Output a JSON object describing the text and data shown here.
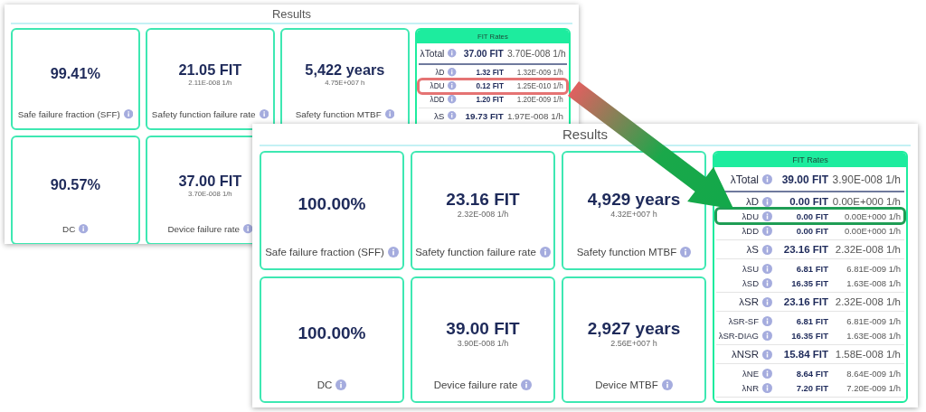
{
  "screens": [
    {
      "title": "Results",
      "cards": [
        {
          "value": "99.41%",
          "label": "Safe failure fraction (SFF)"
        },
        {
          "value": "21.05 FIT",
          "sub": "2.11E-008 1/h",
          "label": "Safety function failure rate"
        },
        {
          "value": "5,422 years",
          "sub": "4.75E+007 h",
          "label": "Safety function MTBF"
        },
        {
          "value": "90.57%",
          "label": "DC"
        },
        {
          "value": "37.00 FIT",
          "sub": "3.70E-008 1/h",
          "label": "Device failure rate"
        }
      ],
      "fit_rates": {
        "title": "FIT Rates",
        "groups": [
          {
            "rows": [
              {
                "label": "λTotal",
                "value": "37.00 FIT",
                "rate": "3.70E-008 1/h",
                "kind": "total",
                "highlighted": false
              }
            ]
          },
          {
            "rows": [
              {
                "label": "λD",
                "value": "1.32 FIT",
                "rate": "1.32E-009 1/h",
                "kind": "minor",
                "highlighted": false
              },
              {
                "label": "λDU",
                "value": "0.12 FIT",
                "rate": "1.25E-010 1/h",
                "kind": "minor",
                "highlighted": true,
                "color": "#e57373"
              },
              {
                "label": "λDD",
                "value": "1.20 FIT",
                "rate": "1.20E-009 1/h",
                "kind": "minor",
                "highlighted": false
              }
            ]
          },
          {
            "rows": [
              {
                "label": "λS",
                "value": "19.73 FIT",
                "rate": "1.97E-008 1/h",
                "kind": "major",
                "highlighted": false
              }
            ]
          }
        ]
      }
    },
    {
      "title": "Results",
      "cards": [
        {
          "value": "100.00%",
          "label": "Safe failure fraction (SFF)"
        },
        {
          "value": "23.16 FIT",
          "sub": "2.32E-008 1/h",
          "label": "Safety function failure rate"
        },
        {
          "value": "4,929 years",
          "sub": "4.32E+007 h",
          "label": "Safety function MTBF"
        },
        {
          "value": "100.00%",
          "label": "DC"
        },
        {
          "value": "39.00 FIT",
          "sub": "3.90E-008 1/h",
          "label": "Device failure rate"
        },
        {
          "value": "2,927 years",
          "sub": "2.56E+007 h",
          "label": "Device MTBF"
        }
      ],
      "fit_rates": {
        "title": "FIT Rates",
        "groups": [
          {
            "rows": [
              {
                "label": "λTotal",
                "value": "39.00 FIT",
                "rate": "3.90E-008 1/h",
                "kind": "total",
                "highlighted": false
              }
            ]
          },
          {
            "rows": [
              {
                "label": "λD",
                "value": "0.00 FIT",
                "rate": "0.00E+000 1/h",
                "kind": "major",
                "highlighted": false
              },
              {
                "label": "λDU",
                "value": "0.00 FIT",
                "rate": "0.00E+000 1/h",
                "kind": "minor",
                "highlighted": true,
                "color": "#1f9d55"
              },
              {
                "label": "λDD",
                "value": "0.00 FIT",
                "rate": "0.00E+000 1/h",
                "kind": "minor",
                "highlighted": false
              }
            ]
          },
          {
            "rows": [
              {
                "label": "λS",
                "value": "23.16 FIT",
                "rate": "2.32E-008 1/h",
                "kind": "major",
                "highlighted": false
              }
            ]
          },
          {
            "rows": [
              {
                "label": "λSU",
                "value": "6.81 FIT",
                "rate": "6.81E-009 1/h",
                "kind": "minor",
                "highlighted": false
              },
              {
                "label": "λSD",
                "value": "16.35 FIT",
                "rate": "1.63E-008 1/h",
                "kind": "minor",
                "highlighted": false
              }
            ]
          },
          {
            "rows": [
              {
                "label": "λSR",
                "value": "23.16 FIT",
                "rate": "2.32E-008 1/h",
                "kind": "major",
                "highlighted": false
              }
            ]
          },
          {
            "rows": [
              {
                "label": "λSR-SF",
                "value": "6.81 FIT",
                "rate": "6.81E-009 1/h",
                "kind": "minor",
                "highlighted": false
              },
              {
                "label": "λSR-DIAG",
                "value": "16.35 FIT",
                "rate": "1.63E-008 1/h",
                "kind": "minor",
                "highlighted": false
              }
            ]
          },
          {
            "rows": [
              {
                "label": "λNSR",
                "value": "15.84 FIT",
                "rate": "1.58E-008 1/h",
                "kind": "major",
                "highlighted": false
              }
            ]
          },
          {
            "rows": [
              {
                "label": "λNE",
                "value": "8.64 FIT",
                "rate": "8.64E-009 1/h",
                "kind": "minor",
                "highlighted": false
              },
              {
                "label": "λNR",
                "value": "7.20 FIT",
                "rate": "7.20E-009 1/h",
                "kind": "minor",
                "highlighted": false
              }
            ]
          }
        ]
      }
    }
  ]
}
